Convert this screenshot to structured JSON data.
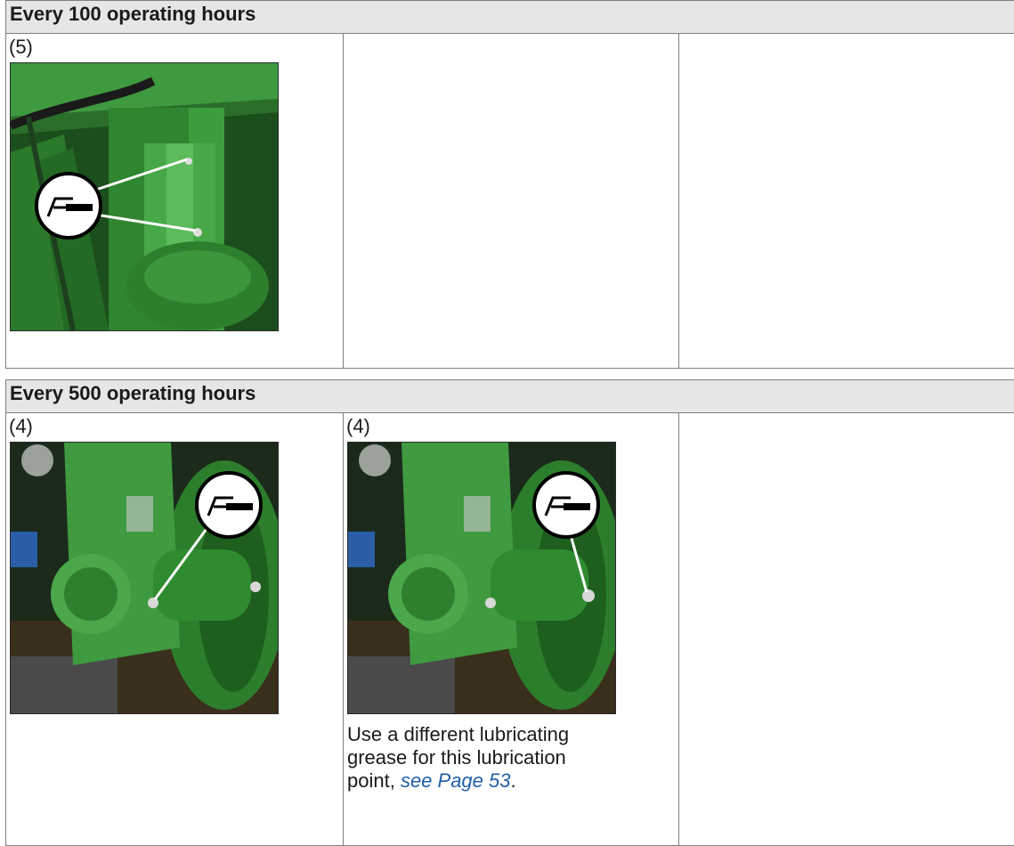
{
  "section_100": {
    "heading": "Every 100 operating hours",
    "points": [
      {
        "label": "(5)"
      }
    ]
  },
  "section_500": {
    "heading": "Every 500 operating hours",
    "points": [
      {
        "label": "(4)"
      },
      {
        "label": "(4)",
        "note_text": "Use a different lubricating grease for this lubrication point, ",
        "note_link": "see Page 53",
        "note_end": "."
      }
    ]
  },
  "colors": {
    "machine_green": "#2e8a2e",
    "header_bg": "#e6e6e6",
    "link": "#1f5fa8"
  },
  "icons": [
    "grease-gun-icon"
  ]
}
